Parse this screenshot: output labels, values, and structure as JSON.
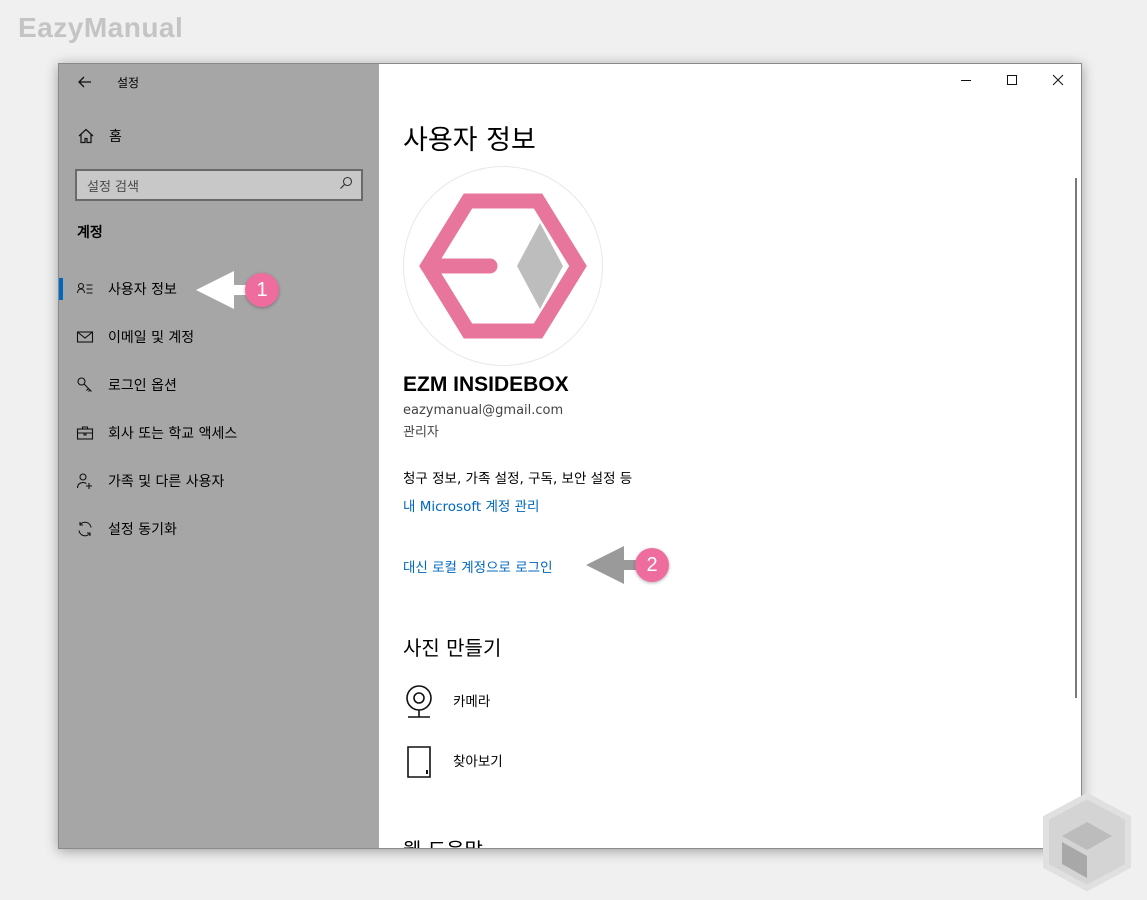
{
  "watermark": "EazyManual",
  "window": {
    "title": "설정",
    "controls": [
      "minimize",
      "maximize",
      "close"
    ]
  },
  "sidebar": {
    "home_label": "홈",
    "search_placeholder": "설정 검색",
    "section_heading": "계정",
    "items": [
      {
        "label": "사용자 정보",
        "icon": "person-card-icon",
        "active": true
      },
      {
        "label": "이메일 및 계정",
        "icon": "mail-icon",
        "active": false
      },
      {
        "label": "로그인 옵션",
        "icon": "key-icon",
        "active": false
      },
      {
        "label": "회사 또는 학교 액세스",
        "icon": "briefcase-icon",
        "active": false
      },
      {
        "label": "가족 및 다른 사용자",
        "icon": "add-person-icon",
        "active": false
      },
      {
        "label": "설정 동기화",
        "icon": "sync-icon",
        "active": false
      }
    ]
  },
  "main": {
    "page_title": "사용자 정보",
    "account": {
      "name": "EZM INSIDEBOX",
      "email": "eazymanual@gmail.com",
      "role": "관리자"
    },
    "billing_text": "청구 정보, 가족 설정, 구독, 보안 설정 등",
    "ms_account_link": "내 Microsoft 계정 관리",
    "local_account_link": "대신 로컬 계정으로 로그인",
    "photo_section": {
      "heading": "사진 만들기",
      "options": [
        {
          "label": "카메라",
          "icon": "camera-icon"
        },
        {
          "label": "찾아보기",
          "icon": "browse-icon"
        }
      ]
    },
    "cutoff_heading": "웹 도움말"
  },
  "callouts": [
    {
      "number": "1"
    },
    {
      "number": "2"
    }
  ],
  "colors": {
    "accent": "#0067c0",
    "sidebar_bg": "#a6a6a6",
    "callout_pink": "#ee6d9e",
    "logo_pink": "#e8759b",
    "logo_gray": "#bdbdbd"
  }
}
